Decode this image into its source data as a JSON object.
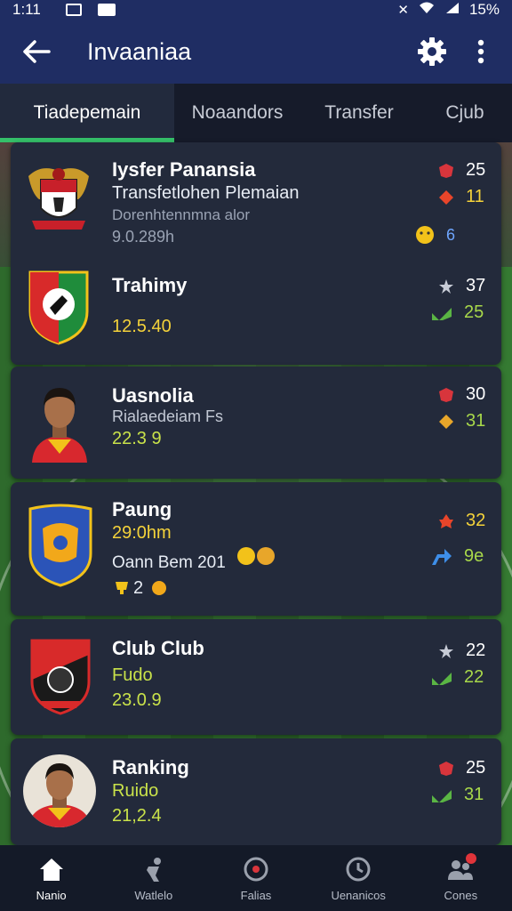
{
  "status_bar": {
    "time": "1:11",
    "battery": "15%"
  },
  "app_bar": {
    "title": "Invaaniaa"
  },
  "tabs": [
    {
      "label": "Tiadepemain",
      "active": true
    },
    {
      "label": "Noaandors",
      "active": false
    },
    {
      "label": "Transfer",
      "active": false
    },
    {
      "label": "Cjub",
      "active": false
    }
  ],
  "cards": [
    {
      "name": "Iysfer Panansia",
      "line1": "Transfetlohen Plemaian",
      "line2": "Dorenhtennmna alor",
      "line3": "9.0.289h",
      "stats": [
        {
          "icon": "shield-icon",
          "value": "25"
        },
        {
          "icon": "diamond-icon",
          "value": "11"
        },
        {
          "icon": "face-icon",
          "value": "6"
        }
      ]
    },
    {
      "name": "Trahimy",
      "line1": "12.5.40",
      "stats": [
        {
          "icon": "star-icon",
          "value": "37"
        },
        {
          "icon": "thumb-icon",
          "value": "25"
        }
      ]
    },
    {
      "name": "Uasnolia",
      "line1": "Rialaedeiam Fs",
      "line2": "22.3 9",
      "stats": [
        {
          "icon": "shield-icon",
          "value": "30"
        },
        {
          "icon": "gem-icon",
          "value": "31"
        }
      ]
    },
    {
      "name": "Paung",
      "line1": "29:0hm",
      "line2": "Oann Bem 201",
      "line3": "2",
      "stats": [
        {
          "icon": "flame-icon",
          "value": "32"
        },
        {
          "icon": "arrow-icon",
          "value": "9e"
        }
      ]
    },
    {
      "name": "Club Club",
      "line1": "Fudo",
      "line2": "23.0.9",
      "stats": [
        {
          "icon": "star-icon",
          "value": "22"
        },
        {
          "icon": "thumb-icon",
          "value": "22"
        }
      ]
    },
    {
      "name": "Ranking",
      "line1": "Ruido",
      "line2": "21,2.4",
      "stats": [
        {
          "icon": "shield-icon",
          "value": "25"
        },
        {
          "icon": "thumb-icon",
          "value": "31"
        }
      ]
    }
  ],
  "bottom_nav": [
    {
      "label": "Nanio",
      "icon": "home-icon",
      "active": true
    },
    {
      "label": "Watlelo",
      "icon": "player-icon",
      "active": false
    },
    {
      "label": "Falias",
      "icon": "ball-icon",
      "active": false
    },
    {
      "label": "Uenanicos",
      "icon": "stopwatch-icon",
      "active": false
    },
    {
      "label": "Cones",
      "icon": "people-icon",
      "active": false
    }
  ],
  "colors": {
    "app_bar": "#1f2d63",
    "accent_green": "#35c06a",
    "card": "#232a3b"
  }
}
